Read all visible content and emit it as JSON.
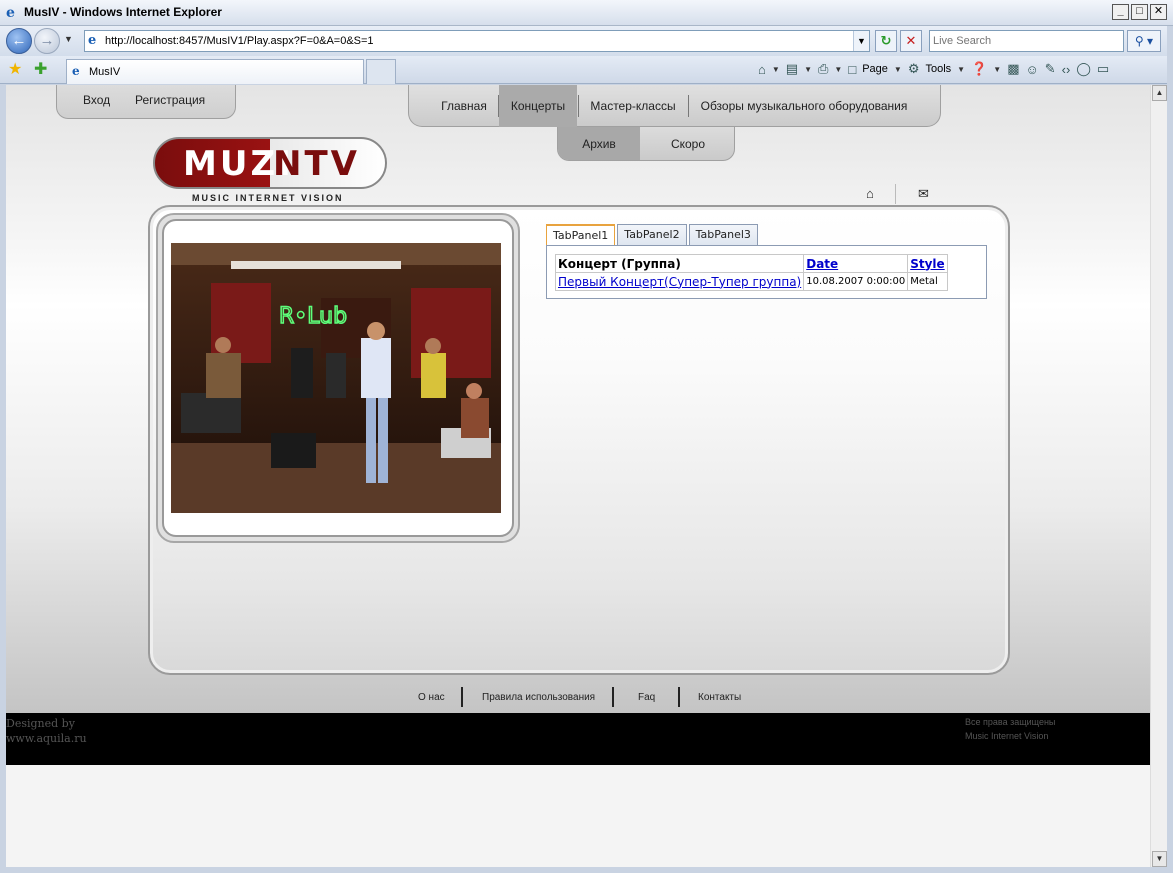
{
  "window": {
    "title": "MusIV - Windows Internet Explorer",
    "min": "_",
    "max": "□",
    "close": "✕"
  },
  "browser": {
    "address": "http://localhost:8457/MusIV1/Play.aspx?F=0&A=0&S=1",
    "search_placeholder": "Live Search",
    "tab_title": "MusIV",
    "page_label": "Page",
    "tools_label": "Tools"
  },
  "auth": {
    "login": "Вход",
    "register": "Регистрация"
  },
  "main_menu": [
    {
      "label": "Главная"
    },
    {
      "label": "Концерты",
      "active": true
    },
    {
      "label": "Мастер-классы"
    },
    {
      "label": "Обзоры музыкального оборудования"
    }
  ],
  "sub_menu": [
    {
      "label": "Архив",
      "active": true
    },
    {
      "label": "Скоро"
    }
  ],
  "logo": {
    "part1": "MUZI",
    "part2": "NTV",
    "tagline": "MUSIC INTERNET VISION"
  },
  "tabs": [
    {
      "label": "TabPanel1",
      "active": true
    },
    {
      "label": "TabPanel2"
    },
    {
      "label": "TabPanel3"
    }
  ],
  "grid": {
    "headers": [
      "Концерт (Группа)",
      "Date",
      "Style"
    ],
    "rows": [
      [
        "Первый Концерт(Супер-Тупер группа)",
        "10.08.2007 0:00:00",
        "Metal"
      ]
    ]
  },
  "video": {
    "sign_text": "R•Lub"
  },
  "footer": {
    "links": [
      "О нас",
      "Правила использования",
      "Faq",
      "Контакты"
    ],
    "designed_line1": "Designed by",
    "designed_line2": "www.aquila.ru",
    "rights_line1": "Все права защищены",
    "rights_line2": "Music  Internet  Vision"
  },
  "colors": {
    "logo_red": "#7a0d0d",
    "active_tab_border": "#e8a33e",
    "link_blue": "#0000cc"
  }
}
